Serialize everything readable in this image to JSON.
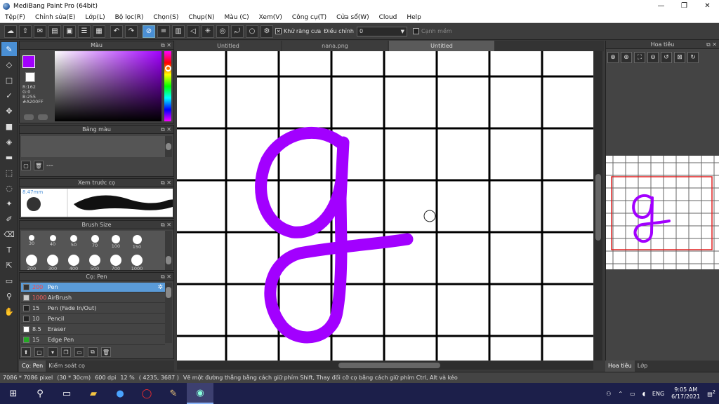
{
  "app": {
    "title": "MediBang Paint Pro (64bit)",
    "window_buttons": [
      "—",
      "❐",
      "✕"
    ]
  },
  "menu": [
    "Tệp(F)",
    "Chỉnh sửa(E)",
    "Lớp(L)",
    "Bộ lọc(R)",
    "Chọn(S)",
    "Chụp(N)",
    "Màu (C)",
    "Xem(V)",
    "Công cụ(T)",
    "Cửa sổ(W)",
    "Cloud",
    "Help"
  ],
  "toolbar": {
    "antialias_label": "Khử răng cưa",
    "adjust_label": "Điều chỉnh",
    "adjust_value": "0",
    "snap_label": "Cạnh mềm"
  },
  "panels": {
    "color": {
      "title": "Màu",
      "values": [
        "R:162",
        "G:0",
        "B:255",
        "#A200FF"
      ],
      "color_hex": "#A200FF"
    },
    "palette": {
      "title": "Bảng màu",
      "footer_text": "---"
    },
    "brush_preview": {
      "title": "Xem trước cọ",
      "size_label": "8.47mm"
    },
    "brush_size": {
      "title": "Brush Size",
      "sizes": [
        "30",
        "40",
        "50",
        "70",
        "100",
        "150",
        "200",
        "300",
        "400",
        "500",
        "700",
        "1000"
      ]
    },
    "brushes": {
      "title": "Cọ: Pen",
      "items": [
        {
          "size": "200",
          "name": "Pen",
          "color": "#333333",
          "selected": true
        },
        {
          "size": "1000",
          "name": "AirBrush",
          "color": "#cccccc",
          "selected": false
        },
        {
          "size": "15",
          "name": "Pen (Fade In/Out)",
          "color": "#222222",
          "selected": false
        },
        {
          "size": "10",
          "name": "Pencil",
          "color": "#222222",
          "selected": false
        },
        {
          "size": "8.5",
          "name": "Eraser",
          "color": "#ffffff",
          "selected": false
        },
        {
          "size": "15",
          "name": "Edge Pen",
          "color": "#22aa22",
          "selected": false
        }
      ]
    },
    "left_tabs": [
      "Cọ: Pen",
      "Kiểm soát cọ"
    ]
  },
  "documents": {
    "tabs": [
      "Untitled",
      "nana.png",
      "Untitled"
    ],
    "active": 2
  },
  "navigator": {
    "title": "Hoa tiêu",
    "tabs": [
      "Hoa tiêu",
      "Lớp"
    ]
  },
  "status": {
    "size": "7086 * 7086 pixel",
    "physical": "(30 * 30cm)",
    "dpi": "600 dpi",
    "zoom": "12 %",
    "coords": "( 4235, 3687 )",
    "hint": "Vẽ một đường thẳng bằng cách giữ phím Shift, Thay đổi cỡ cọ bằng cách giữ phím Ctrl, Alt và kéo"
  },
  "taskbar": {
    "time": "9:05 AM",
    "date": "6/17/2021",
    "lang": "ENG",
    "notifications": "2"
  },
  "colors": {
    "stroke": "#A200FF",
    "accent": "#4a8fd4",
    "grid": "#000000"
  }
}
